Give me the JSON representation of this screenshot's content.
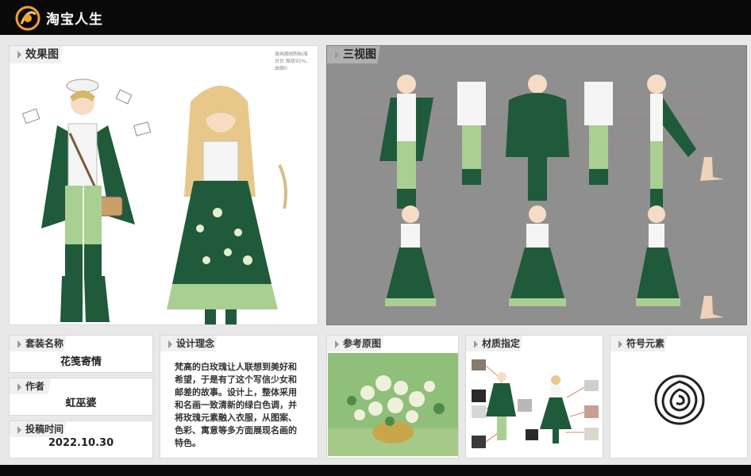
{
  "app": {
    "name": "淘宝人生"
  },
  "effect_panel": {
    "title": "效果图",
    "note": "显画面帧制标准台台 缩放95%，由缩0"
  },
  "three_view_panel": {
    "title": "三视图"
  },
  "info": {
    "set_name_label": "套装名称",
    "set_name_value": "花笺寄情",
    "author_label": "作者",
    "author_value": "虹巫婆",
    "submit_time_label": "投稿时间",
    "submit_time_value": "2022.10.30"
  },
  "concept": {
    "title": "设计理念",
    "text": "梵高的白玫瑰让人联想到美好和希望，于是有了这个写信少女和邮差的故事。设计上，整体采用和名画一致清新的绿白色调，并将玫瑰元素融入衣服，从图案、色彩、寓意等多方面展现名画的特色。"
  },
  "reference": {
    "title": "参考原图"
  },
  "material": {
    "title": "材质指定"
  },
  "symbol": {
    "title": "符号元素"
  },
  "colors": {
    "accent_green": "#1f5a3a",
    "light_green": "#a9cf92",
    "topbar": "#0a0a0a",
    "logo_orange": "#f0a030"
  }
}
